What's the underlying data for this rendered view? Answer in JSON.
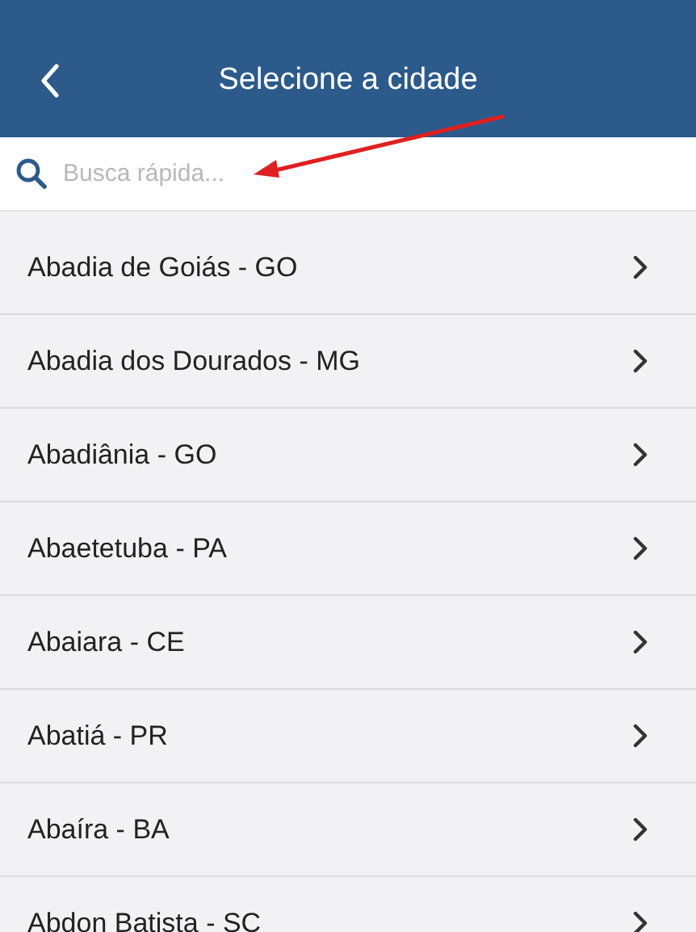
{
  "header": {
    "title": "Selecione a cidade"
  },
  "search": {
    "placeholder": "Busca rápida..."
  },
  "cities": [
    {
      "name": "Abadia de Goiás - GO"
    },
    {
      "name": "Abadia dos Dourados - MG"
    },
    {
      "name": "Abadiânia - GO"
    },
    {
      "name": "Abaetetuba - PA"
    },
    {
      "name": "Abaiara - CE"
    },
    {
      "name": "Abatiá - PR"
    },
    {
      "name": "Abaíra - BA"
    },
    {
      "name": "Abdon Batista - SC"
    }
  ]
}
